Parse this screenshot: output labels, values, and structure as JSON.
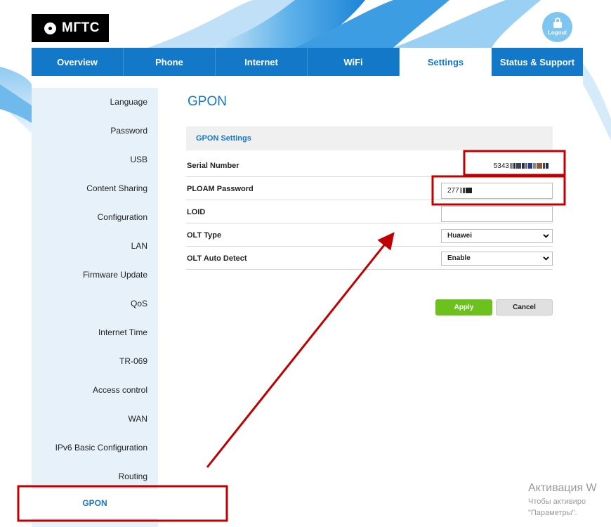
{
  "brand": {
    "logo_text": "МГТС"
  },
  "header": {
    "logout_label": "Logout"
  },
  "nav": {
    "items": [
      {
        "label": "Overview"
      },
      {
        "label": "Phone"
      },
      {
        "label": "Internet"
      },
      {
        "label": "WiFi"
      },
      {
        "label": "Settings",
        "active": true
      },
      {
        "label": "Status & Support"
      }
    ]
  },
  "sidebar": {
    "items": [
      {
        "label": "Language"
      },
      {
        "label": "Password"
      },
      {
        "label": "USB"
      },
      {
        "label": "Content Sharing"
      },
      {
        "label": "Configuration"
      },
      {
        "label": "LAN"
      },
      {
        "label": "Firmware Update"
      },
      {
        "label": "QoS"
      },
      {
        "label": "Internet Time"
      },
      {
        "label": "TR-069"
      },
      {
        "label": "Access control"
      },
      {
        "label": "WAN"
      },
      {
        "label": "IPv6 Basic Configuration"
      },
      {
        "label": "Routing"
      },
      {
        "label": "GPON",
        "active": true
      }
    ]
  },
  "main": {
    "title": "GPON",
    "section_title": "GPON Settings",
    "fields": {
      "serial": {
        "label": "Serial Number",
        "value": "5343"
      },
      "ploam": {
        "label": "PLOAM Password",
        "value": "277"
      },
      "loid": {
        "label": "LOID",
        "value": ""
      },
      "olt_type": {
        "label": "OLT Type",
        "value": "Huawei"
      },
      "olt_auto": {
        "label": "OLT Auto Detect",
        "value": "Enable"
      }
    },
    "buttons": {
      "apply": "Apply",
      "cancel": "Cancel"
    }
  },
  "watermark": {
    "title": "Активация W",
    "line1": "Чтобы активиро",
    "line2": "\"Параметры\"."
  },
  "colors": {
    "brand_blue": "#1478c8",
    "apply_green": "#6dc11f",
    "annotation_red": "#c00000",
    "sidebar_bg": "#e7f1fa"
  }
}
